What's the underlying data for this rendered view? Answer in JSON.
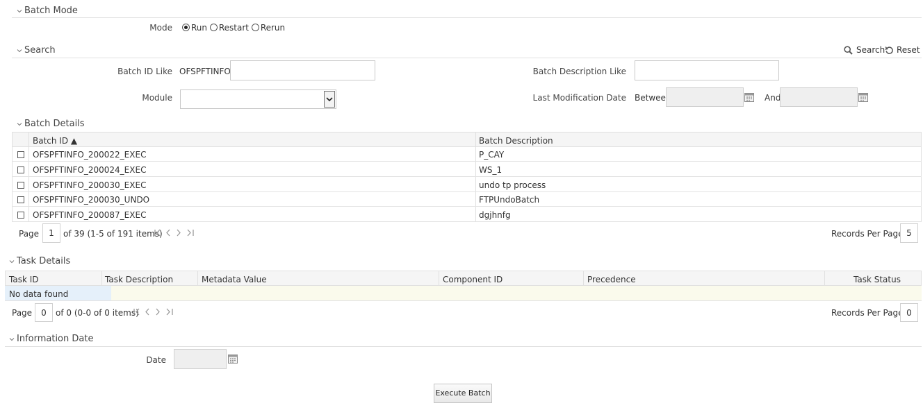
{
  "batch_mode": {
    "title": "Batch Mode",
    "mode_label": "Mode",
    "options": [
      "Run",
      "Restart",
      "Rerun"
    ],
    "selected": "Run"
  },
  "search": {
    "title": "Search",
    "search_label": "Search",
    "reset_label": "Reset",
    "batch_id_like_label": "Batch ID Like",
    "batch_id_prefix": "OFSPFTINFO_",
    "batch_id_value": "",
    "batch_desc_like_label": "Batch Description Like",
    "batch_desc_value": "",
    "module_label": "Module",
    "module_value": "",
    "last_mod_label": "Last Modification Date",
    "between_label": "Between",
    "and_label": "And"
  },
  "batch_details": {
    "title": "Batch Details",
    "columns": [
      "Batch ID ▲",
      "Batch Description"
    ],
    "rows": [
      {
        "id": "OFSPFTINFO_200022_EXEC",
        "desc": "P_CAY"
      },
      {
        "id": "OFSPFTINFO_200024_EXEC",
        "desc": "WS_1"
      },
      {
        "id": "OFSPFTINFO_200030_EXEC",
        "desc": "undo tp process"
      },
      {
        "id": "OFSPFTINFO_200030_UNDO",
        "desc": "FTPUndoBatch"
      },
      {
        "id": "OFSPFTINFO_200087_EXEC",
        "desc": "dgjhnfg"
      }
    ],
    "pager": {
      "page_label": "Page",
      "page_value": "1",
      "summary": "of 39 (1-5 of 191 items)",
      "records_per_page_label": "Records Per Page",
      "records_per_page_value": "5"
    }
  },
  "task_details": {
    "title": "Task Details",
    "columns": [
      "Task ID",
      "Task Description",
      "Metadata Value",
      "Component ID",
      "Precedence",
      "Task Status"
    ],
    "empty_text": "No data found",
    "pager": {
      "page_label": "Page",
      "page_value": "0",
      "summary": "of 0 (0-0 of 0 items)",
      "records_per_page_label": "Records Per Page",
      "records_per_page_value": "0"
    }
  },
  "information_date": {
    "title": "Information Date",
    "date_label": "Date"
  },
  "execute_button": "Execute Batch",
  "icons": {
    "chevron": "chevron-down-icon",
    "search": "magnifier-icon",
    "reset": "reset-icon",
    "calendar": "calendar-icon",
    "pager": "first-prev-next-last-icons"
  }
}
